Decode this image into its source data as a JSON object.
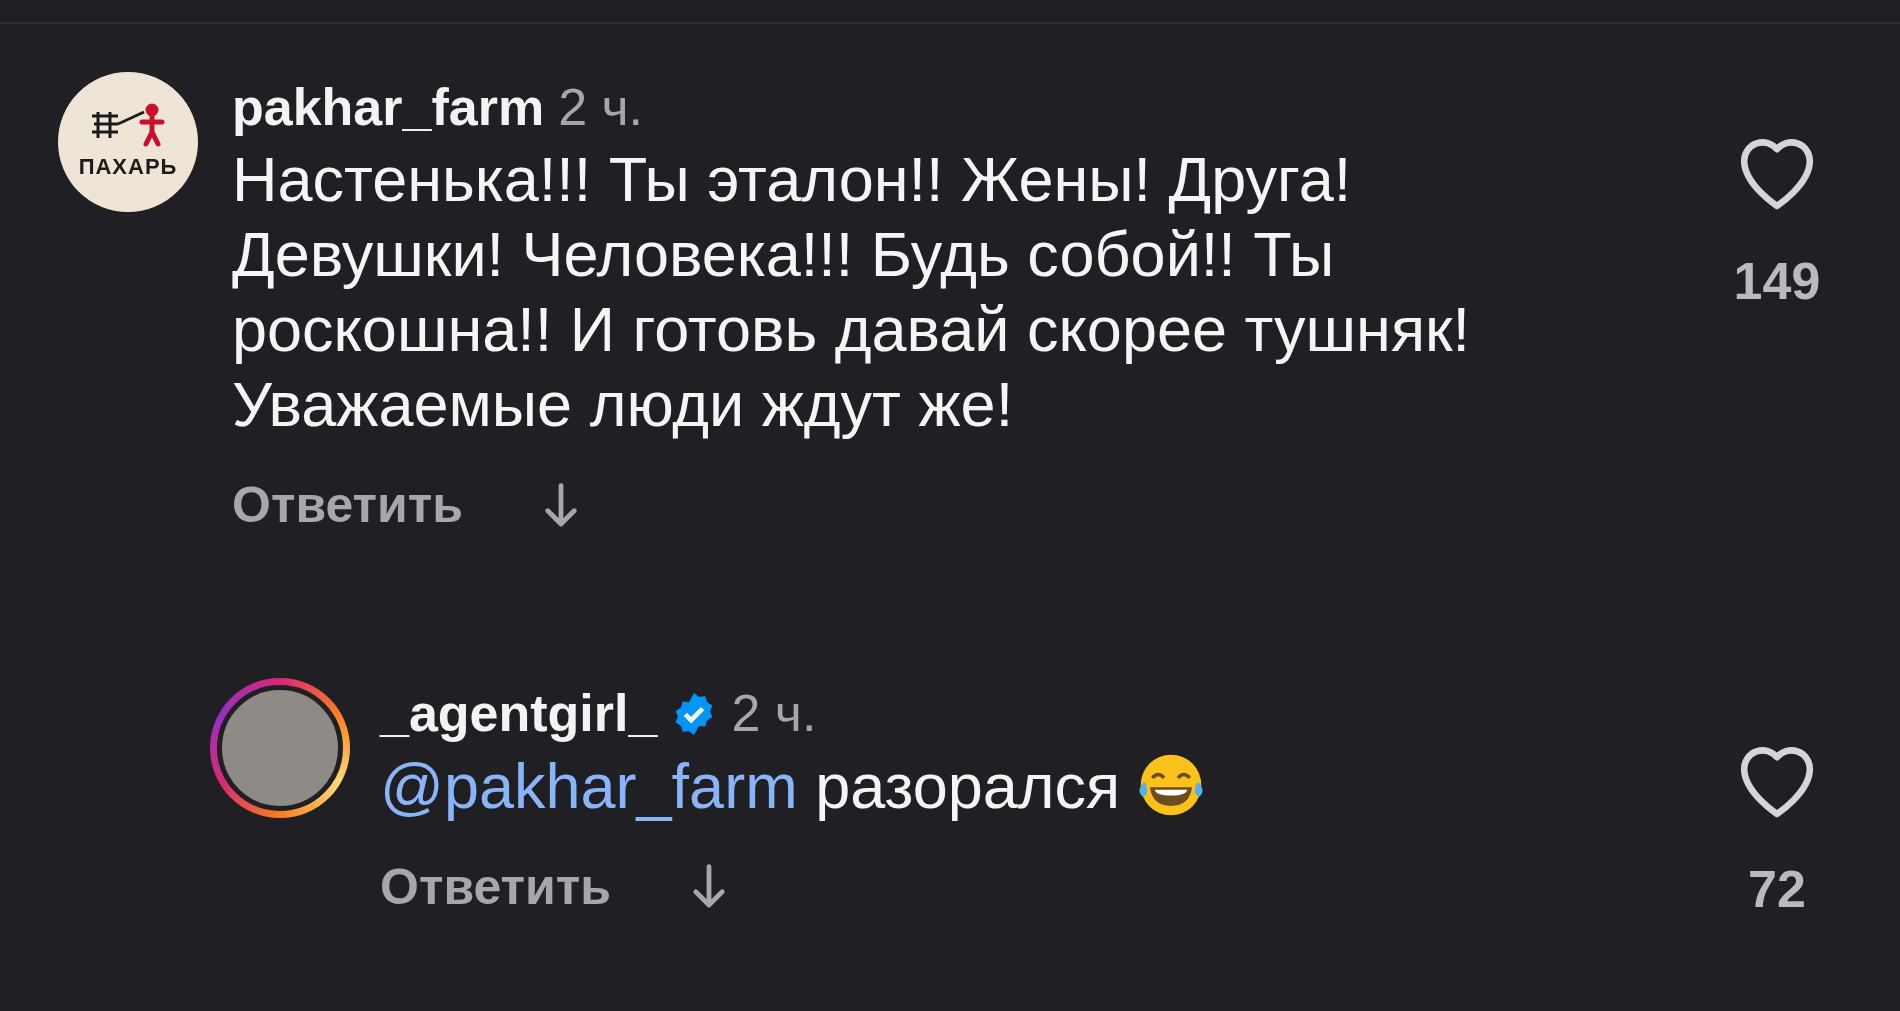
{
  "comments": [
    {
      "kind": "comment",
      "avatar": {
        "kind": "logo",
        "label": "ПАХАРЬ"
      },
      "username": "pakhar_farm",
      "verified": false,
      "time": "2 ч.",
      "text": "Настенька!!! Ты эталон!! Жены! Друга! Девушки! Человека!!! Будь собой!! Ты роскошна!! И готовь давай скорее тушняк! Уважаемые люди ждут же!",
      "emoji": false,
      "reply": "Ответить",
      "likes": "149",
      "liked": false
    },
    {
      "kind": "reply",
      "avatar": {
        "kind": "photo",
        "story_ring": true
      },
      "username": "_agentgirl_",
      "verified": true,
      "time": "2 ч.",
      "mention": "@pakhar_farm",
      "text": "разорался",
      "emoji": true,
      "reply": "Ответить",
      "likes": "72",
      "liked": false
    }
  ]
}
